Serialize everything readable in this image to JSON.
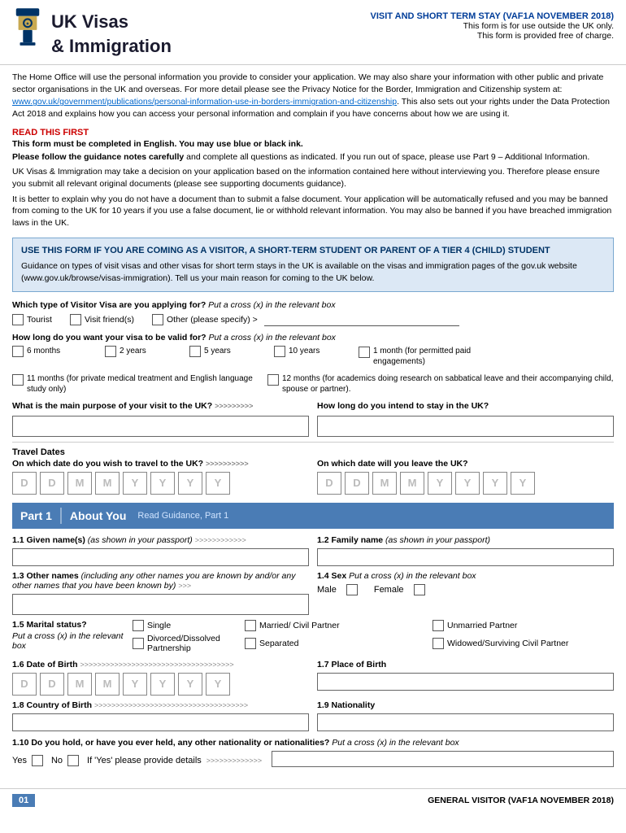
{
  "header": {
    "form_title": "VISIT AND SHORT TERM STAY (VAF1A NOVEMBER 2018)",
    "subtitle1": "This form is for use outside the UK only.",
    "subtitle2": "This form is provided free of charge.",
    "org_line1": "UK Visas",
    "org_line2": "& Immigration"
  },
  "intro": {
    "paragraph1": "The Home Office will use the personal information you provide to consider your application. We may also share your information with other public and private sector organisations in the UK and overseas. For more detail please see the Privacy Notice for the Border, Immigration and Citizenship system at: www.gov.uk/government/publications/personal-information-use-in-borders-immigration-and-citizenship. This also sets out your rights under the Data Protection Act 2018 and explains how you can access your personal information and complain if you have concerns about how we are using it.",
    "link_text": "www.gov.uk/government/publications/personal-information-use-in-borders-immigration-and-citizenship",
    "read_first": "READ THIS FIRST",
    "bold1": "This form must be completed in English. You may use blue or black ink.",
    "bold2_start": "Please follow the guidance notes carefully",
    "bold2_end": " and complete all questions as indicated. If you run out of space, please use Part 9 – Additional Information.",
    "para2": "UK Visas & Immigration may take a decision on your application based on the information contained here without interviewing you. Therefore please ensure you submit all relevant original documents (please see supporting documents guidance).",
    "para3": "It is better to explain why you do not have a document than to submit a false document. Your application will be automatically refused and you may be banned from coming to the UK for 10 years if you use a false document, lie or withhold relevant information. You may also be banned if you have breached immigration laws in the UK."
  },
  "info_box": {
    "title": "USE THIS FORM IF YOU ARE COMING AS A VISITOR, A SHORT-TERM STUDENT OR PARENT OF A TIER 4 (CHILD) STUDENT",
    "body": "Guidance on types of visit visas and other visas for short term stays in the UK is available on the visas and immigration pages of the gov.uk website (www.gov.uk/browse/visas-immigration). Tell us your main reason for coming to the UK below."
  },
  "visitor_visa_section": {
    "question": "Which type of Visitor Visa are you applying for?",
    "italic": "Put a cross (x) in the relevant box",
    "options": [
      "Tourist",
      "Visit friend(s)",
      "Other (please specify) >"
    ]
  },
  "visa_duration_section": {
    "question": "How long do you want your visa to be valid for?",
    "italic": "Put a cross (x) in the relevant box",
    "options": [
      {
        "label": "6 months"
      },
      {
        "label": "2 years"
      },
      {
        "label": "5 years"
      },
      {
        "label": "10 years"
      },
      {
        "label": "1 month (for permitted paid engagements)"
      },
      {
        "label": "11 months (for private medical treatment and English language study only)"
      },
      {
        "label": "12 months (for academics doing research on sabbatical leave and their accompanying child, spouse or partner)."
      }
    ]
  },
  "main_purpose": {
    "question": "What is the main purpose of your visit to the UK?",
    "arrows": ">>>>>>>>>"
  },
  "intend_stay": {
    "question": "How long do you intend to stay in the UK?"
  },
  "travel_dates": {
    "title": "Travel Dates",
    "depart_q": "On which date do you wish to travel to the UK?",
    "depart_arrows": ">>>>>>>>>>",
    "leave_q": "On which date will you leave the UK?",
    "dd": "D D",
    "mm": "M M",
    "yyyy": "Y Y Y Y"
  },
  "part1": {
    "number": "Part 1",
    "title": "About You",
    "guidance": "Read Guidance, Part 1"
  },
  "fields": {
    "f11_label": "1.1 Given name(s)",
    "f11_italic": "(as shown in your passport)",
    "f11_arrows": ">>>>>>>>>>>>",
    "f12_label": "1.2 Family name",
    "f12_italic": "(as shown in your passport)",
    "f13_label": "1.3 Other names",
    "f13_italic": "(including any other names you are known by and/or any other names that you have been known by)",
    "f13_arrows": ">>>",
    "f14_label": "1.4 Sex",
    "f14_italic": "Put a cross (x) in the relevant box",
    "f14_male": "Male",
    "f14_female": "Female",
    "f15_label": "1.5 Marital status?",
    "f15_italic": "Put a cross (x) in the relevant box",
    "f15_options": [
      "Single",
      "Married/ Civil Partner",
      "Unmarried Partner",
      "Divorced/Dissolved Partnership",
      "Separated",
      "Widowed/Surviving Civil Partner"
    ],
    "f16_label": "1.6 Date of Birth",
    "f16_arrows": ">>>>>>>>>>>>>>>>>>>>>>>>>>>>>>>>>>>>",
    "f17_label": "1.7 Place of Birth",
    "f18_label": "1.8 Country of Birth",
    "f18_arrows": ">>>>>>>>>>>>>>>>>>>>>>>>>>>>>>>>>>>>",
    "f19_label": "1.9 Nationality",
    "f110_label": "1.10 Do you hold, or have you ever held, any other nationality or nationalities?",
    "f110_italic": "Put a cross (x) in the relevant box",
    "f110_yes": "Yes",
    "f110_no": "No",
    "f110_ifyes": "If 'Yes' please provide details",
    "f110_arrows": ">>>>>>>>>>>>>"
  },
  "footer": {
    "page": "01",
    "text": "GENERAL VISITOR (VAF1A NOVEMBER 2018)"
  }
}
